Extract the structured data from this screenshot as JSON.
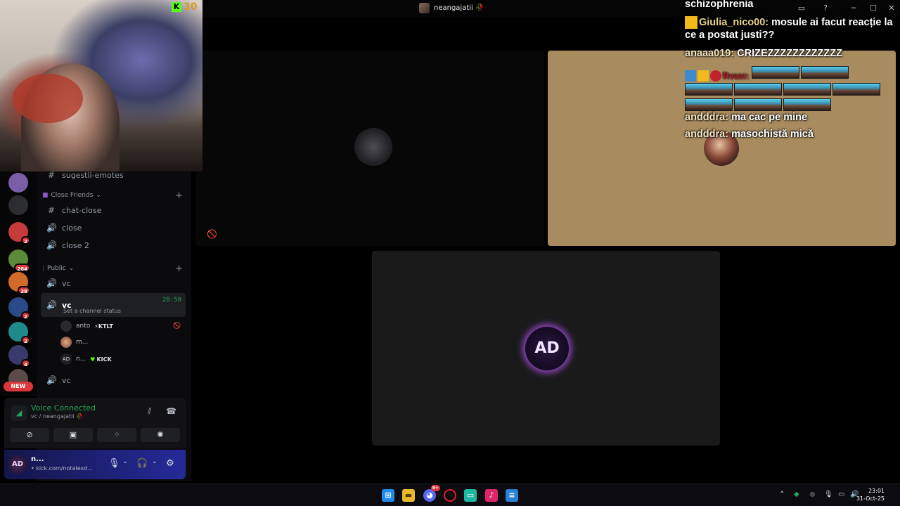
{
  "window": {
    "title": "neangajatii 🥀"
  },
  "webcam": {
    "kick_logo": "K",
    "kick_count": "30"
  },
  "servers": [
    {
      "badge": "",
      "color": "#7b5ea7"
    },
    {
      "badge": "",
      "color": "#2b2d31"
    },
    {
      "badge": "2",
      "color": "#c53b3b"
    },
    {
      "badge": "264",
      "color": "#5a8a3a"
    },
    {
      "badge": "28",
      "color": "#d26a2a"
    },
    {
      "badge": "2",
      "color": "#2a4a8a"
    },
    {
      "badge": "2",
      "color": "#1f8a8a"
    },
    {
      "badge": "4",
      "color": "#3a3a6a"
    },
    {
      "badge": "",
      "color": "#5a4a4a"
    }
  ],
  "new_pill": "NEW",
  "channels": {
    "partial_top": "sugestii-emotes",
    "category_close": "Close Friends",
    "close_channels": [
      {
        "icon": "#",
        "label": "chat-close"
      },
      {
        "icon": "🔊",
        "label": "close"
      },
      {
        "icon": "🔊",
        "label": "close 2"
      }
    ],
    "category_public": "Public",
    "public_vc_1": "vc",
    "active_vc": {
      "label": "vc",
      "time": "20:50",
      "status": "Set a channel status"
    },
    "members": [
      {
        "name": "anto",
        "tag": "⚡KTLT"
      },
      {
        "name": "m...",
        "tag": ""
      },
      {
        "name": "n...",
        "tag": "KICK"
      }
    ],
    "public_vc_3": "vc"
  },
  "voice_panel": {
    "title": "Voice Connected",
    "subtitle": "vc / neangajatii 🥀"
  },
  "user_panel": {
    "avatar": "AD",
    "name": "n...",
    "sub": "• kick.com/notalexd..."
  },
  "stage": {
    "tile3_logo": "AD"
  },
  "chat": {
    "lines": [
      {
        "user": "",
        "text": "schizophrenia"
      },
      {
        "user": "Giulia_nico00:",
        "text": "mosule ai facut reacție la ce a postat justi??"
      },
      {
        "user": "anaaa019:",
        "text": "CRIZEZZZZZZZZZZZZ"
      },
      {
        "user": "Rvasr:",
        "text": ""
      },
      {
        "user": "andddra:",
        "text": "ma cac pe mine"
      },
      {
        "user": "andddra:",
        "text": "masochistă mică"
      }
    ]
  },
  "taskbar": {
    "time": "23:01",
    "date": "31-Oct-25",
    "discord_badge": "9+"
  }
}
